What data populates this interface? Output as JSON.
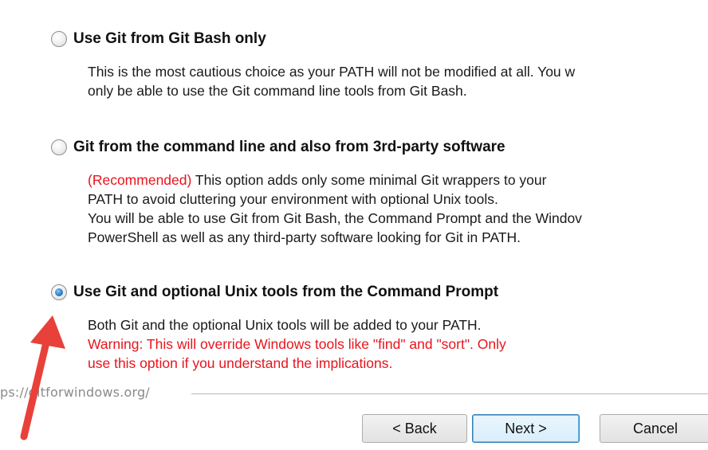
{
  "options": [
    {
      "label": "Use Git from Git Bash only",
      "checked": false,
      "description": [
        {
          "text": "This is the most cautious choice as your PATH will not be modified at all. You w",
          "style": "normal"
        },
        {
          "text": "only be able to use the Git command line tools from Git Bash.",
          "style": "normal"
        }
      ]
    },
    {
      "label": "Git from the command line and also from 3rd-party software",
      "checked": false,
      "recommended_tag": "(Recommended)",
      "description": [
        {
          "text": " This option adds only some minimal Git wrappers to your",
          "style": "normal"
        },
        {
          "text": "PATH to avoid cluttering your environment with optional Unix tools.",
          "style": "normal"
        },
        {
          "text": "You will be able to use Git from Git Bash, the Command Prompt and the Windov",
          "style": "normal"
        },
        {
          "text": "PowerShell as well as any third-party software looking for Git in PATH.",
          "style": "normal"
        }
      ]
    },
    {
      "label": "Use Git and optional Unix tools from the Command Prompt",
      "checked": true,
      "description": [
        {
          "text": "Both Git and the optional Unix tools will be added to your PATH.",
          "style": "normal"
        },
        {
          "text": "Warning: This will override Windows tools like \"find\" and \"sort\". Only",
          "style": "warning"
        },
        {
          "text": "use this option if you understand the implications.",
          "style": "warning"
        }
      ]
    }
  ],
  "footer": {
    "url": "ps://gitforwindows.org/"
  },
  "buttons": {
    "back": "< Back",
    "next": "Next >",
    "cancel": "Cancel"
  },
  "colors": {
    "warning": "#e8141c",
    "annotation_arrow": "#e8413a"
  },
  "icons": {
    "annotation": "red-arrow-icon"
  }
}
